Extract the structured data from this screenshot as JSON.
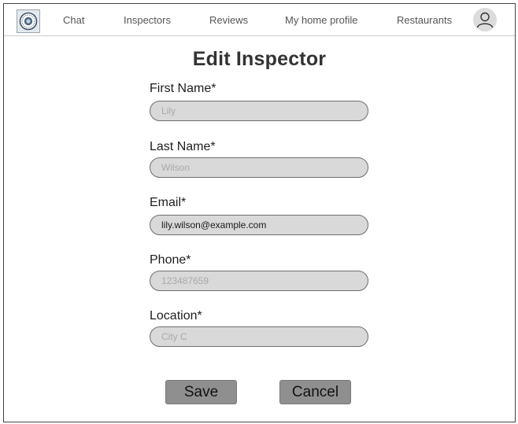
{
  "nav": {
    "logo_icon": "badge-logo-icon",
    "links": [
      "Chat",
      "Inspectors",
      "Reviews",
      "My home profile",
      "Restaurants"
    ],
    "avatar_icon": "user-icon"
  },
  "page": {
    "title": "Edit Inspector"
  },
  "form": {
    "first_name": {
      "label": "First Name*",
      "placeholder": "Lily",
      "value": ""
    },
    "last_name": {
      "label": "Last Name*",
      "placeholder": "Wilson",
      "value": ""
    },
    "email": {
      "label": "Email*",
      "placeholder": "",
      "value": "lily.wilson@example.com"
    },
    "phone": {
      "label": "Phone*",
      "placeholder": "123487659",
      "value": ""
    },
    "location": {
      "label": "Location*",
      "placeholder": "City C",
      "value": ""
    }
  },
  "actions": {
    "save": "Save",
    "cancel": "Cancel"
  },
  "colors": {
    "input_bg": "#d9d9d9",
    "button_bg": "#8f8f8f",
    "nav_border": "#cfcfcf"
  }
}
